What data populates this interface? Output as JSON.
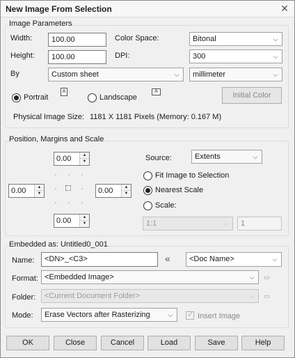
{
  "window": {
    "title": "New Image From Selection",
    "close_glyph": "✕"
  },
  "image_params": {
    "group_title": "Image Parameters",
    "width_label": "Width:",
    "width_value": "100.00",
    "height_label": "Height:",
    "height_value": "100.00",
    "by_label": "By",
    "by_value": "Custom sheet",
    "color_space_label": "Color Space:",
    "color_space_value": "Bitonal",
    "dpi_label": "DPI:",
    "dpi_value": "300",
    "unit_value": "millimeter",
    "portrait_label": "Portrait",
    "landscape_label": "Landscape",
    "orientation_selected": "portrait",
    "page_icon_glyph": "A",
    "initial_color_label": "Initial Color",
    "physical_size_label": "Physical Image Size:",
    "physical_size_value": "1181 X 1181 Pixels (Memory: 0.167 M)"
  },
  "position": {
    "group_title": "Position, Margins and Scale",
    "top_value": "0.00",
    "left_value": "0.00",
    "right_value": "0.00",
    "bottom_value": "0.00",
    "source_label": "Source:",
    "source_value": "Extents",
    "fit_label": "Fit Image to Selection",
    "nearest_label": "Nearest Scale",
    "scale_label": "Scale:",
    "scale_selected": "nearest",
    "scale_ratio_value": "1:1",
    "scale_number_value": "1"
  },
  "embedded": {
    "group_title": "Embedded as: Untitled0_001",
    "name_label": "Name:",
    "name_value": "<DN>_<C3>",
    "insert_glyph": "«",
    "doc_name_value": "<Doc Name>",
    "format_label": "Format:",
    "format_value": "<Embedded Image>",
    "folder_label": "Folder:",
    "folder_value": "<Current Document Folder>",
    "mode_label": "Mode:",
    "mode_value": "Erase Vectors after Rasterizing",
    "insert_image_label": "Insert Image",
    "insert_image_checked": true
  },
  "buttons": {
    "ok": "OK",
    "close": "Close",
    "cancel": "Cancel",
    "load": "Load",
    "save": "Save",
    "help": "Help"
  },
  "icons": {
    "dropdown_arrow": "⌵",
    "spin_up": "▲",
    "spin_down": "▼",
    "browse_glyph": "▭"
  }
}
